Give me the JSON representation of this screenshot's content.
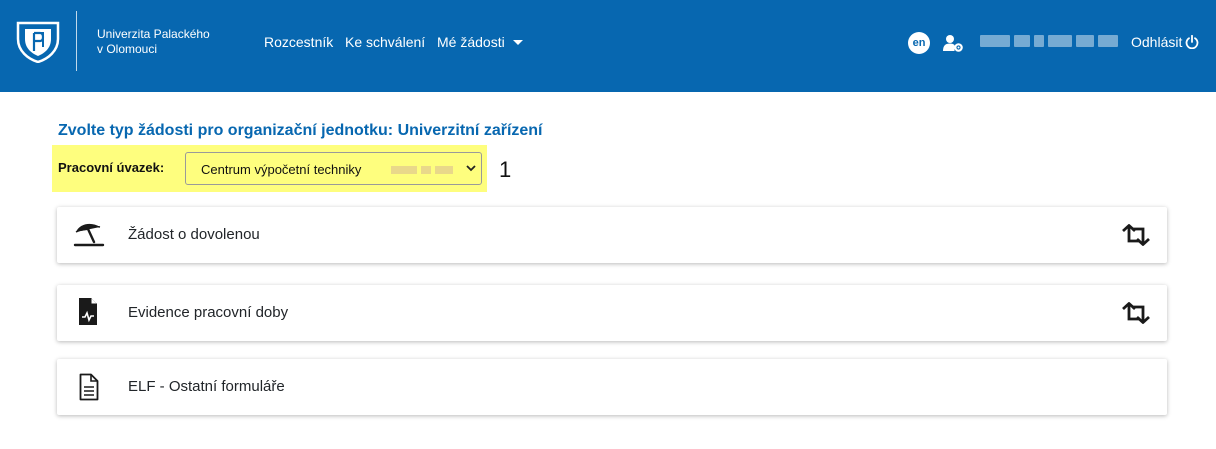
{
  "header": {
    "university_line1": "Univerzita Palackého",
    "university_line2": "v Olomouci",
    "nav": [
      {
        "label": "Rozcestník"
      },
      {
        "label": "Ke schválení"
      },
      {
        "label": "Mé žádosti"
      }
    ],
    "lang_badge": "en",
    "logout_label": "Odhlásit",
    "bg_color": "#0767b0"
  },
  "main": {
    "title": "Zvolte typ žádosti pro organizační jednotku: Univerzitní zařízení",
    "select_label": "Pracovní úvazek:",
    "select_value": "Centrum výpočetní techniky",
    "marker": "1",
    "highlight_color": "#fefe7e",
    "cards": [
      {
        "title": "Žádost o dovolenou",
        "icon": "beach-umbrella-icon",
        "action_icon": "swap-icon"
      },
      {
        "title": "Evidence pracovní doby",
        "icon": "file-waveform-icon",
        "action_icon": "swap-icon"
      },
      {
        "title": "ELF - Ostatní formuláře",
        "icon": "document-icon"
      }
    ]
  }
}
